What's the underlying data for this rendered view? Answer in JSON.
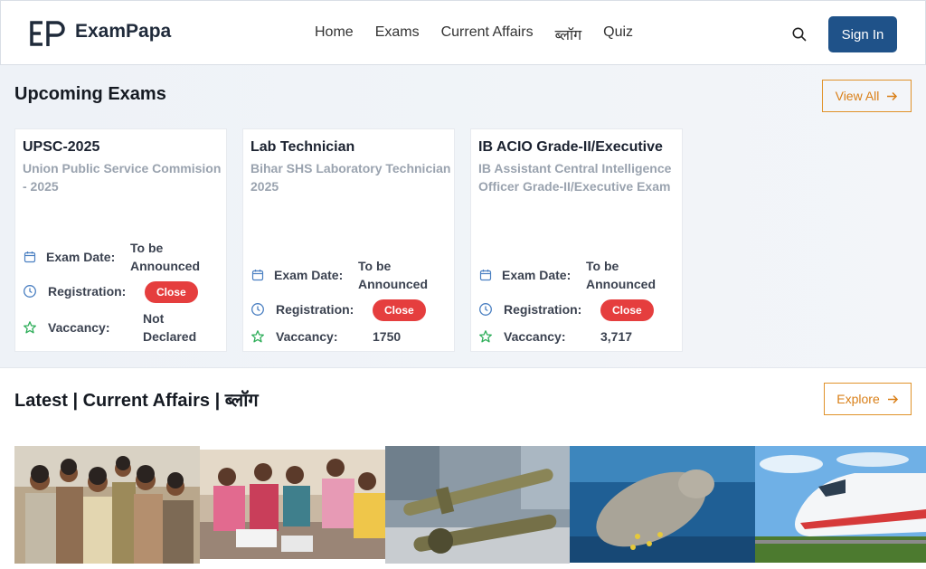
{
  "header": {
    "logo_text": "ExamPapa",
    "nav": [
      "Home",
      "Exams",
      "Current Affairs",
      "ब्लॉग",
      "Quiz"
    ],
    "sign_in": "Sign In"
  },
  "upcoming": {
    "title": "Upcoming Exams",
    "view_all": "View All",
    "cards": [
      {
        "title": "UPSC-2025",
        "subtitle": "Union Public Service Commision - 2025",
        "exam_date_label": "Exam Date:",
        "exam_date": "To be Announced",
        "registration_label": "Registration:",
        "registration_status": "Close",
        "vacancy_label": "Vaccancy:",
        "vacancy": "Not Declared"
      },
      {
        "title": "Lab Technician",
        "subtitle": "Bihar SHS Laboratory Technician 2025",
        "exam_date_label": "Exam Date:",
        "exam_date": "To be Announced",
        "registration_label": "Registration:",
        "registration_status": "Close",
        "vacancy_label": "Vaccancy:",
        "vacancy": "1750"
      },
      {
        "title": "IB ACIO Grade-II/Executive",
        "subtitle": "IB Assistant Central Intelligence Officer Grade-II/Executive Exam",
        "exam_date_label": "Exam Date:",
        "exam_date": "To be Announced",
        "registration_label": "Registration:",
        "registration_status": "Close",
        "vacancy_label": "Vaccancy:",
        "vacancy": "3,717"
      }
    ]
  },
  "latest": {
    "title": "Latest | Current Affairs | ब्लॉग",
    "explore": "Explore"
  },
  "colors": {
    "brand": "#1f5289",
    "accent": "#e0922a",
    "badge": "#e53e3e",
    "icon_blue": "#4a7fc1",
    "icon_green": "#2fae5a"
  },
  "icons": [
    "search-icon",
    "calendar-icon",
    "clock-icon",
    "star-icon",
    "arrow-right-icon"
  ]
}
